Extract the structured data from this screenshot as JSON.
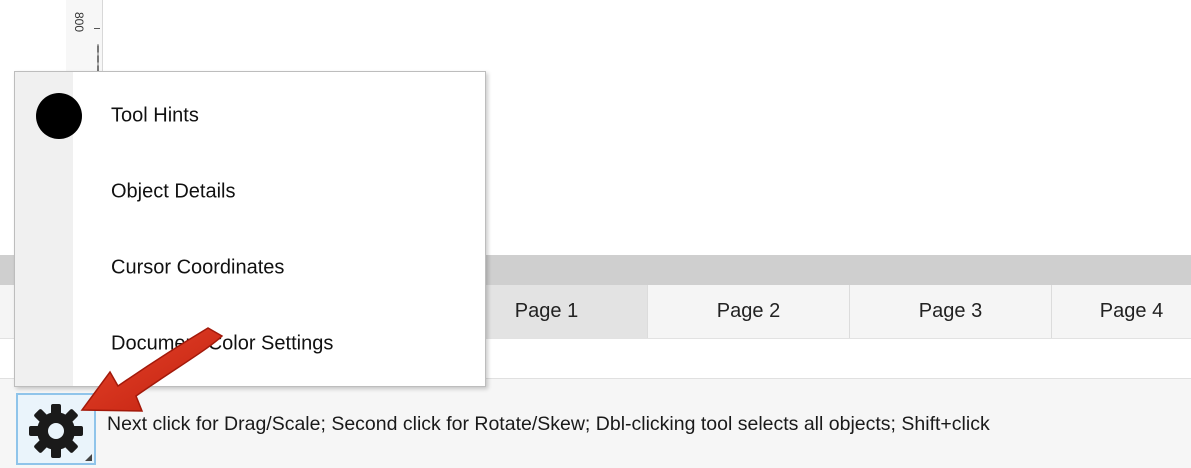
{
  "ruler": {
    "label": "800"
  },
  "page_tabs": [
    {
      "label": "Page 1",
      "active": true
    },
    {
      "label": "Page 2",
      "active": false
    },
    {
      "label": "Page 3",
      "active": false
    },
    {
      "label": "Page 4",
      "active": false
    }
  ],
  "popup_menu": {
    "items": [
      {
        "label": "Tool Hints",
        "selected": true
      },
      {
        "label": "Object Details",
        "selected": false
      },
      {
        "label": "Cursor Coordinates",
        "selected": false
      },
      {
        "label": "Document Color Settings",
        "selected": false
      }
    ]
  },
  "status_bar": {
    "settings_icon": "gear-icon",
    "hint_text": "Next click for Drag/Scale; Second click for Rotate/Skew; Dbl-clicking tool selects all objects; Shift+click"
  },
  "annotation": {
    "arrow_color": "#d42a16"
  },
  "colors": {
    "menu_gutter": "#f0f0f0",
    "active_tab": "#e3e3e3",
    "gear_highlight_border": "#8fc4ea"
  }
}
